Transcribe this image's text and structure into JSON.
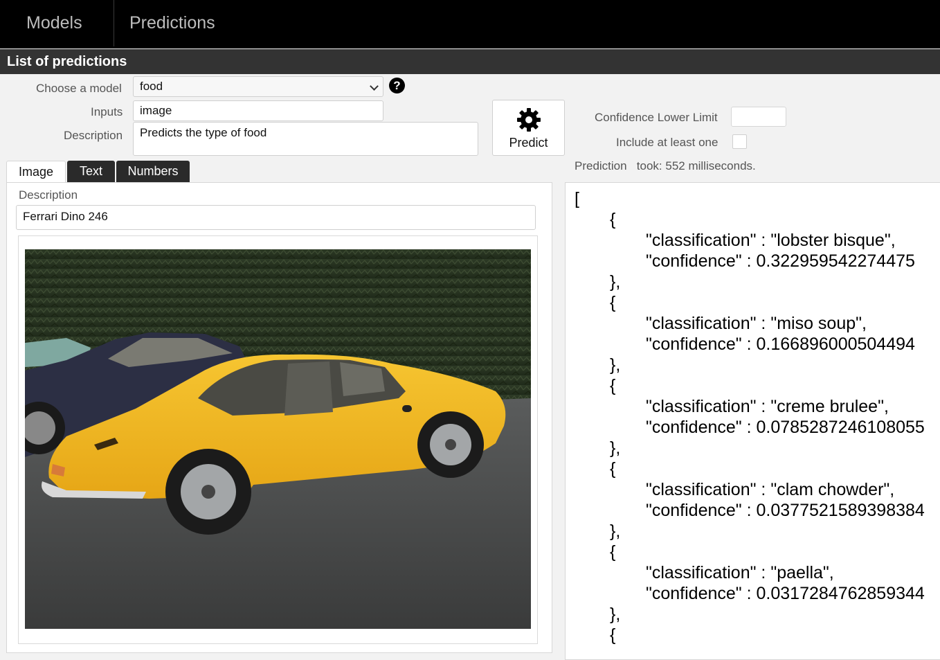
{
  "nav": {
    "models": "Models",
    "predictions": "Predictions"
  },
  "title": "List of predictions",
  "form": {
    "choose_model_label": "Choose a model",
    "model_value": "food",
    "help_icon": "question-circle-icon",
    "inputs_label": "Inputs",
    "inputs_value": "image",
    "description_label": "Description",
    "description_value": "Predicts the type of food"
  },
  "predict_button": {
    "label": "Predict",
    "icon": "gear-icon"
  },
  "options": {
    "confidence_label": "Confidence Lower Limit",
    "include_label": "Include at least one",
    "prediction_label": "Prediction",
    "took_text": "took: 552 milliseconds."
  },
  "tabs": [
    {
      "label": "Image",
      "active": true
    },
    {
      "label": "Text",
      "active": false
    },
    {
      "label": "Numbers",
      "active": false
    }
  ],
  "image_panel": {
    "description_label": "Description",
    "description_value": "Ferrari Dino 246"
  },
  "results": [
    {
      "classification": "lobster bisque",
      "confidence": "0.322959542274475"
    },
    {
      "classification": "miso soup",
      "confidence": "0.166896000504494"
    },
    {
      "classification": "creme brulee",
      "confidence": "0.0785287246108055"
    },
    {
      "classification": "clam chowder",
      "confidence": "0.0377521589398384"
    },
    {
      "classification": "paella",
      "confidence": "0.0317284762859344"
    }
  ],
  "json_tokens": {
    "open_array": "[",
    "open_obj": "{",
    "close_obj": "},",
    "classification_key": "\"classification\" : ",
    "confidence_key": "\"confidence\" : "
  },
  "colors": {
    "topnav": "#000000",
    "titlebar": "#333333",
    "car": "#f2b821"
  }
}
